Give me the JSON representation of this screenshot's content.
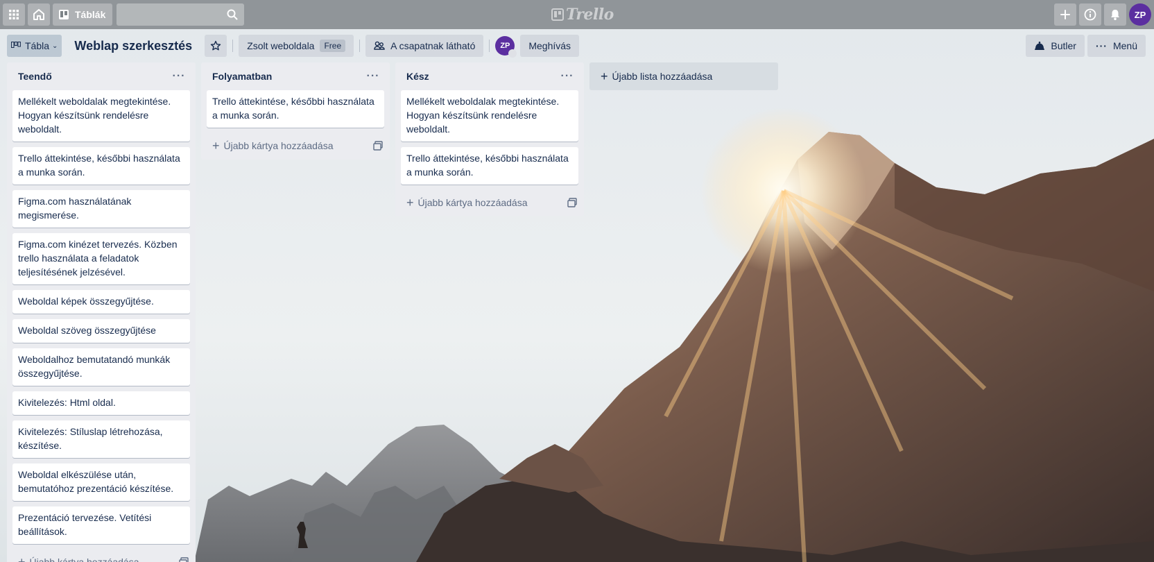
{
  "header": {
    "boards_label": "Táblák",
    "search_placeholder": "",
    "logo_text": "Trello",
    "avatar_initials": "ZP"
  },
  "board": {
    "view_label": "Tábla",
    "title": "Weblap szerkesztés",
    "workspace_label": "Zsolt weboldala",
    "plan_badge": "Free",
    "visibility_label": "A csapatnak látható",
    "member_initials": "ZP",
    "invite_label": "Meghívás",
    "butler_label": "Butler",
    "menu_label": "Menü"
  },
  "lists": [
    {
      "title": "Teendő",
      "cards": [
        "Mellékelt weboldalak megtekintése. Hogyan készítsünk rendelésre weboldalt.",
        "Trello áttekintése, későbbi használata a munka során.",
        "Figma.com használatának megismerése.",
        "Figma.com kinézet tervezés. Közben trello használata a feladatok teljesítésének jelzésével.",
        "Weboldal képek összegyűjtése.",
        "Weboldal szöveg összegyűjtése",
        "Weboldalhoz bemutatandó munkák összegyűjtése.",
        "Kivitelezés: Html oldal.",
        "Kivitelezés: Stíluslap létrehozása, készítése.",
        "Weboldal elkészülése után, bemutatóhoz prezentáció készítése.",
        "Prezentáció tervezése. Vetítési beállítások."
      ],
      "add_card_label": "Újabb kártya hozzáadása"
    },
    {
      "title": "Folyamatban",
      "cards": [
        "Trello áttekintése, későbbi használata a munka során."
      ],
      "add_card_label": "Újabb kártya hozzáadása"
    },
    {
      "title": "Kész",
      "cards": [
        "Mellékelt weboldalak megtekintése. Hogyan készítsünk rendelésre weboldalt.",
        "Trello áttekintése, későbbi használata a munka során."
      ],
      "add_card_label": "Újabb kártya hozzáadása"
    }
  ],
  "add_list_label": "Újabb lista hozzáadása",
  "icons": {
    "apps": "grid-icon",
    "home": "home-icon",
    "boards": "board-icon",
    "search": "search-icon",
    "create": "plus-icon",
    "info": "info-icon",
    "notifications": "bell-icon",
    "view": "board-view-icon",
    "star": "star-icon",
    "visibility": "team-icon",
    "butler": "butler-icon",
    "menu": "more-icon",
    "template": "card-template-icon"
  }
}
